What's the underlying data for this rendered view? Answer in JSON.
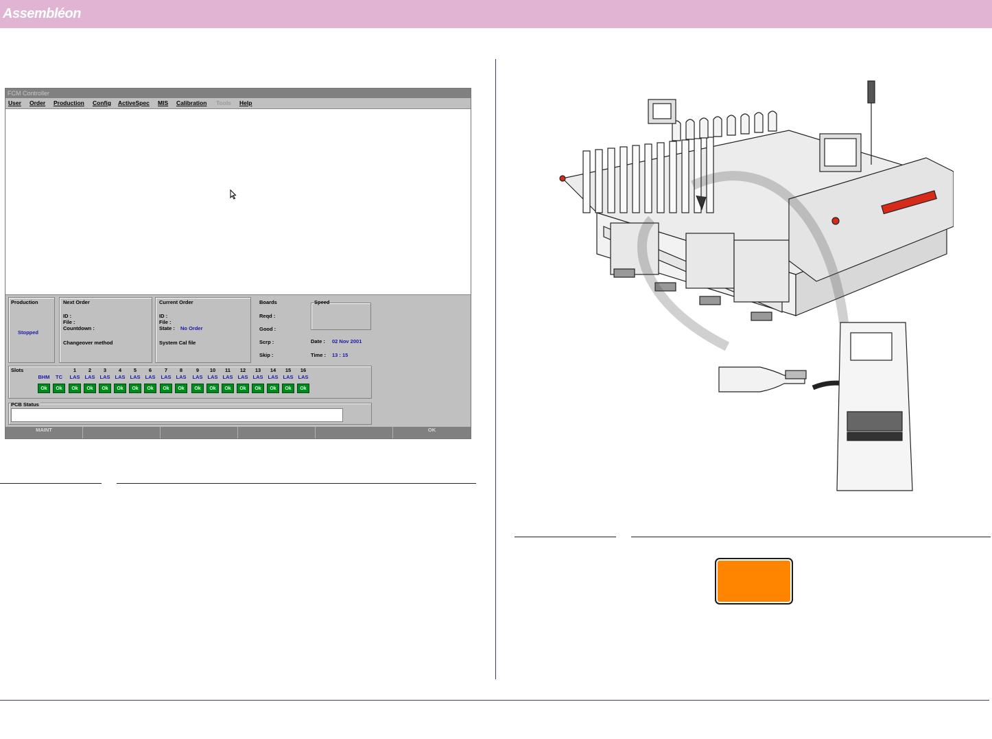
{
  "header": {
    "brand": "Assembléon",
    "accent": "#e0b4d2"
  },
  "app": {
    "title": "FCM Controller",
    "menu": [
      {
        "label": "User",
        "enabled": true
      },
      {
        "label": "Order",
        "enabled": true
      },
      {
        "label": "Production",
        "enabled": true
      },
      {
        "label": "Config",
        "enabled": true
      },
      {
        "label": "ActiveSpec",
        "enabled": true
      },
      {
        "label": "MIS",
        "enabled": true
      },
      {
        "label": "Calibration",
        "enabled": true
      },
      {
        "label": "Tools",
        "enabled": false
      },
      {
        "label": "Help",
        "enabled": true
      }
    ],
    "production": {
      "heading": "Production",
      "status": "Stopped"
    },
    "next_order": {
      "heading": "Next Order",
      "id_label": "ID :",
      "file_label": "File :",
      "countdown_label": "Countdown :",
      "changeover_label": "Changeover method"
    },
    "current_order": {
      "heading": "Current Order",
      "id_label": "ID :",
      "file_label": "File :",
      "state_label": "State :",
      "state_value": "No Order",
      "syscal_label": "System Cal file"
    },
    "boards": {
      "heading": "Boards",
      "reqd": "Reqd :",
      "good": "Good :",
      "scrap": "Scrp :",
      "skip": "Skip :"
    },
    "speed": {
      "heading": "Speed"
    },
    "date": {
      "label": "Date :",
      "value": "02 Nov 2001"
    },
    "time": {
      "label": "Time :",
      "value": "13 : 15"
    },
    "slots": {
      "heading": "Slots",
      "extra": [
        {
          "num": "",
          "type": "BHM",
          "status": "Ok"
        },
        {
          "num": "",
          "type": "TC",
          "status": "Ok"
        }
      ],
      "items": [
        {
          "num": "1",
          "type": "LAS",
          "status": "Ok"
        },
        {
          "num": "2",
          "type": "LAS",
          "status": "Ok"
        },
        {
          "num": "3",
          "type": "LAS",
          "status": "Ok"
        },
        {
          "num": "4",
          "type": "LAS",
          "status": "Ok"
        },
        {
          "num": "5",
          "type": "LAS",
          "status": "Ok"
        },
        {
          "num": "6",
          "type": "LAS",
          "status": "Ok"
        },
        {
          "num": "7",
          "type": "LAS",
          "status": "Ok"
        },
        {
          "num": "8",
          "type": "LAS",
          "status": "Ok"
        },
        {
          "num": "9",
          "type": "LAS",
          "status": "Ok"
        },
        {
          "num": "10",
          "type": "LAS",
          "status": "Ok"
        },
        {
          "num": "11",
          "type": "LAS",
          "status": "Ok"
        },
        {
          "num": "12",
          "type": "LAS",
          "status": "Ok"
        },
        {
          "num": "13",
          "type": "LAS",
          "status": "Ok"
        },
        {
          "num": "14",
          "type": "LAS",
          "status": "Ok"
        },
        {
          "num": "15",
          "type": "LAS",
          "status": "Ok"
        },
        {
          "num": "16",
          "type": "LAS",
          "status": "Ok"
        }
      ]
    },
    "pcb_status": {
      "heading": "PCB Status",
      "value": ""
    },
    "function_keys": [
      "MAINT",
      "",
      "",
      "",
      "",
      "OK"
    ]
  },
  "warning_color": "#ff8400"
}
